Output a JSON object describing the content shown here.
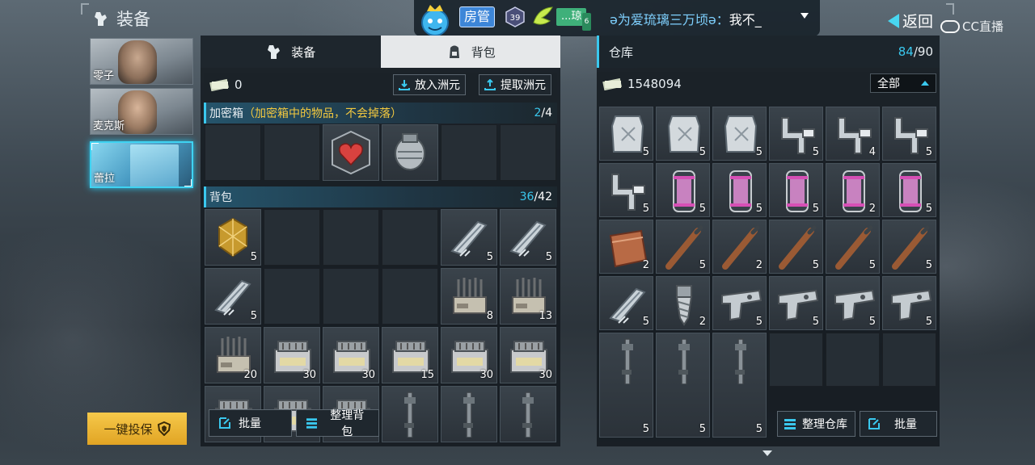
{
  "header": {
    "title": "装备"
  },
  "characters": [
    {
      "name": "零子",
      "selected": false
    },
    {
      "name": "麦克斯",
      "selected": false
    },
    {
      "name": "蕾拉",
      "selected": true
    }
  ],
  "insure_button": "一键投保",
  "chat": {
    "badge_manager": "房管",
    "fan_badge": "...琼",
    "fan_level": "6",
    "sender": "ə为爱琉璃三万顷ə：",
    "message": "我不_"
  },
  "nav": {
    "back": "返回"
  },
  "watermark": "CC直播",
  "left_panel": {
    "tabs": [
      {
        "label": "装备",
        "active": false
      },
      {
        "label": "背包",
        "active": true
      }
    ],
    "cash": "0",
    "deposit_button": "放入洲元",
    "withdraw_button": "提取洲元",
    "safe_box": {
      "label": "加密箱",
      "note": "（加密箱中的物品，不会掉落）",
      "used": "2",
      "total": "/4"
    },
    "backpack": {
      "label": "背包",
      "used": "36",
      "total": "/42"
    },
    "batch_button": "批量",
    "sort_button": "整理背包"
  },
  "right_panel": {
    "title": "仓库",
    "used": "84",
    "total": "/90",
    "cash": "1548094",
    "filter": "全部",
    "sort_button": "整理仓库",
    "batch_button": "批量"
  },
  "safe_items": [
    {
      "icon": "empty"
    },
    {
      "icon": "empty"
    },
    {
      "icon": "heart-emblem-icon"
    },
    {
      "icon": "canister-icon"
    },
    {
      "icon": "empty"
    },
    {
      "icon": "empty"
    }
  ],
  "backpack_items": [
    {
      "icon": "gold-ore-icon",
      "qty": "5"
    },
    {
      "icon": "empty",
      "qty": ""
    },
    {
      "icon": "empty",
      "qty": ""
    },
    {
      "icon": "empty",
      "qty": ""
    },
    {
      "icon": "metal-clip-icon",
      "qty": "5"
    },
    {
      "icon": "metal-clip-icon",
      "qty": "5"
    },
    {
      "icon": "metal-clip-icon",
      "qty": "5"
    },
    {
      "icon": "empty",
      "qty": ""
    },
    {
      "icon": "empty",
      "qty": ""
    },
    {
      "icon": "empty",
      "qty": ""
    },
    {
      "icon": "ammo-rack-icon",
      "qty": "8"
    },
    {
      "icon": "ammo-rack-icon",
      "qty": "13"
    },
    {
      "icon": "ammo-rack-icon",
      "qty": "20"
    },
    {
      "icon": "ammo-box-icon",
      "qty": "30"
    },
    {
      "icon": "ammo-box-icon",
      "qty": "30"
    },
    {
      "icon": "ammo-box-icon",
      "qty": "15"
    },
    {
      "icon": "ammo-box-icon",
      "qty": "30"
    },
    {
      "icon": "ammo-box-icon",
      "qty": "30"
    },
    {
      "icon": "ammo-box-icon",
      "qty": ""
    },
    {
      "icon": "ammo-box-icon",
      "qty": ""
    },
    {
      "icon": "ammo-box-icon",
      "qty": ""
    },
    {
      "icon": "rifle-icon",
      "qty": ""
    },
    {
      "icon": "rifle-icon",
      "qty": ""
    },
    {
      "icon": "rifle-icon",
      "qty": ""
    }
  ],
  "warehouse_items": [
    {
      "icon": "armor-plate-icon",
      "qty": "5"
    },
    {
      "icon": "armor-plate-icon",
      "qty": "5"
    },
    {
      "icon": "armor-plate-icon",
      "qty": "5"
    },
    {
      "icon": "pipe-part-icon",
      "qty": "5"
    },
    {
      "icon": "pipe-part-icon",
      "qty": "4"
    },
    {
      "icon": "pipe-part-icon",
      "qty": "5"
    },
    {
      "icon": "pipe-part-icon",
      "qty": "5"
    },
    {
      "icon": "capsule-icon",
      "qty": "5"
    },
    {
      "icon": "capsule-icon",
      "qty": "5"
    },
    {
      "icon": "capsule-icon",
      "qty": "5"
    },
    {
      "icon": "capsule-icon",
      "qty": "2"
    },
    {
      "icon": "capsule-icon",
      "qty": "5"
    },
    {
      "icon": "leather-wallet-icon",
      "qty": "2"
    },
    {
      "icon": "wood-stick-icon",
      "qty": "5"
    },
    {
      "icon": "wood-stick-icon",
      "qty": "2"
    },
    {
      "icon": "wood-stick-icon",
      "qty": "5"
    },
    {
      "icon": "wood-stick-icon",
      "qty": "5"
    },
    {
      "icon": "wood-stick-icon",
      "qty": "5"
    },
    {
      "icon": "metal-clip-icon",
      "qty": "5"
    },
    {
      "icon": "drill-bit-icon",
      "qty": "2"
    },
    {
      "icon": "pistol-frame-icon",
      "qty": "5"
    },
    {
      "icon": "pistol-frame-icon",
      "qty": "5"
    },
    {
      "icon": "pistol-frame-icon",
      "qty": "5"
    },
    {
      "icon": "pistol-frame-icon",
      "qty": "5"
    }
  ],
  "warehouse_rifles": [
    {
      "icon": "rifle-icon",
      "qty": "5"
    },
    {
      "icon": "rifle-icon",
      "qty": "5"
    },
    {
      "icon": "rifle-icon",
      "qty": "5"
    }
  ]
}
